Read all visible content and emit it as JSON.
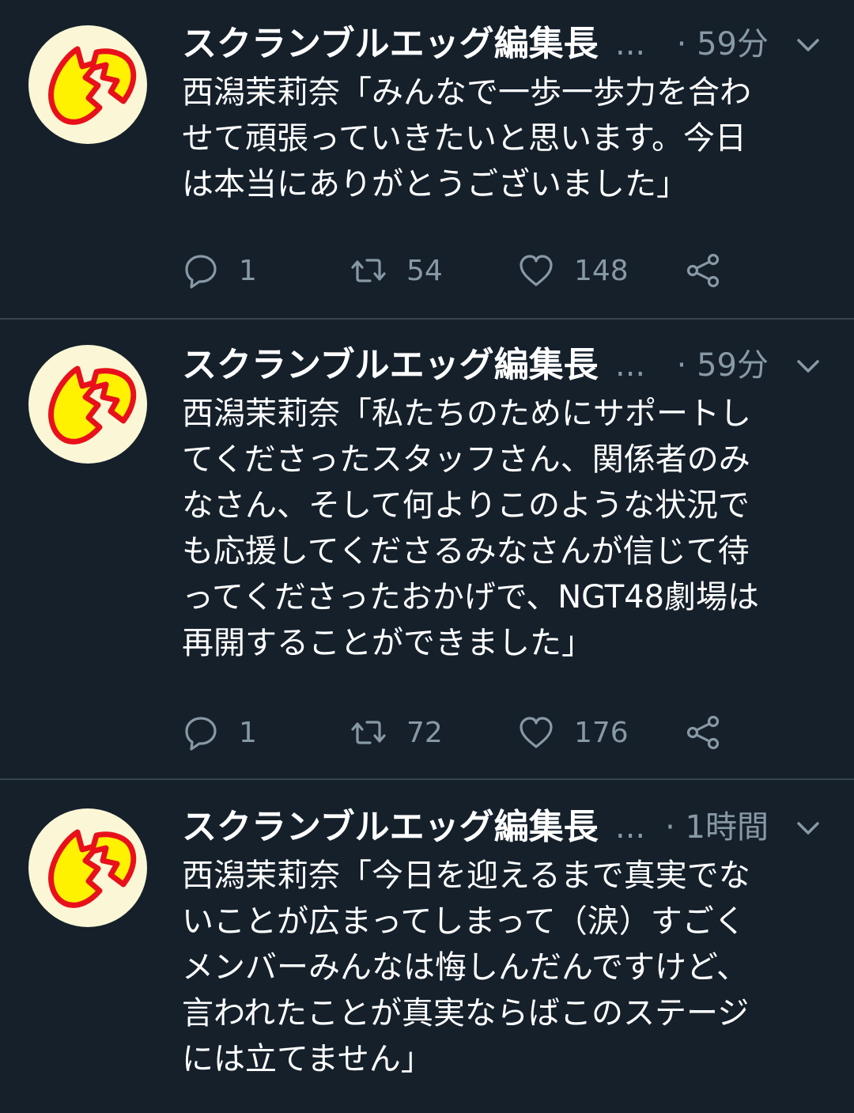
{
  "colors": {
    "background": "#15202b",
    "divider": "#38444d",
    "text_primary": "#ffffff",
    "text_secondary": "#8899a6",
    "avatar_bg": "#fbf7d6",
    "avatar_egg_fill": "#fff200",
    "avatar_egg_stroke": "#e8101a"
  },
  "tweets": [
    {
      "author": "スクランブルエッグ編集長",
      "ellipsis": "...",
      "time": "· 59分",
      "lines": [
        "西潟茉莉奈「みんなで一歩一歩力を合わ",
        "せて頑張っていきたいと思います。今日",
        "は本当にありがとうございました」"
      ],
      "replies": "1",
      "retweets": "54",
      "likes": "148"
    },
    {
      "author": "スクランブルエッグ編集長",
      "ellipsis": "...",
      "time": "· 59分",
      "lines": [
        "西潟茉莉奈「私たちのためにサポートし",
        "てくださったスタッフさん、関係者のみ",
        "なさん、そして何よりこのような状況で",
        "も応援してくださるみなさんが信じて待",
        "ってくださったおかげで、NGT48劇場は",
        "再開することができました」"
      ],
      "replies": "1",
      "retweets": "72",
      "likes": "176"
    },
    {
      "author": "スクランブルエッグ編集長",
      "ellipsis": "...",
      "time": "· 1時間",
      "lines": [
        "西潟茉莉奈「今日を迎えるまで真実でな",
        "いことが広まってしまって（涙）すごく",
        "メンバーみんなは悔しんだんですけど、",
        "言われたことが真実ならばこのステージ",
        "には立てません」"
      ]
    }
  ]
}
